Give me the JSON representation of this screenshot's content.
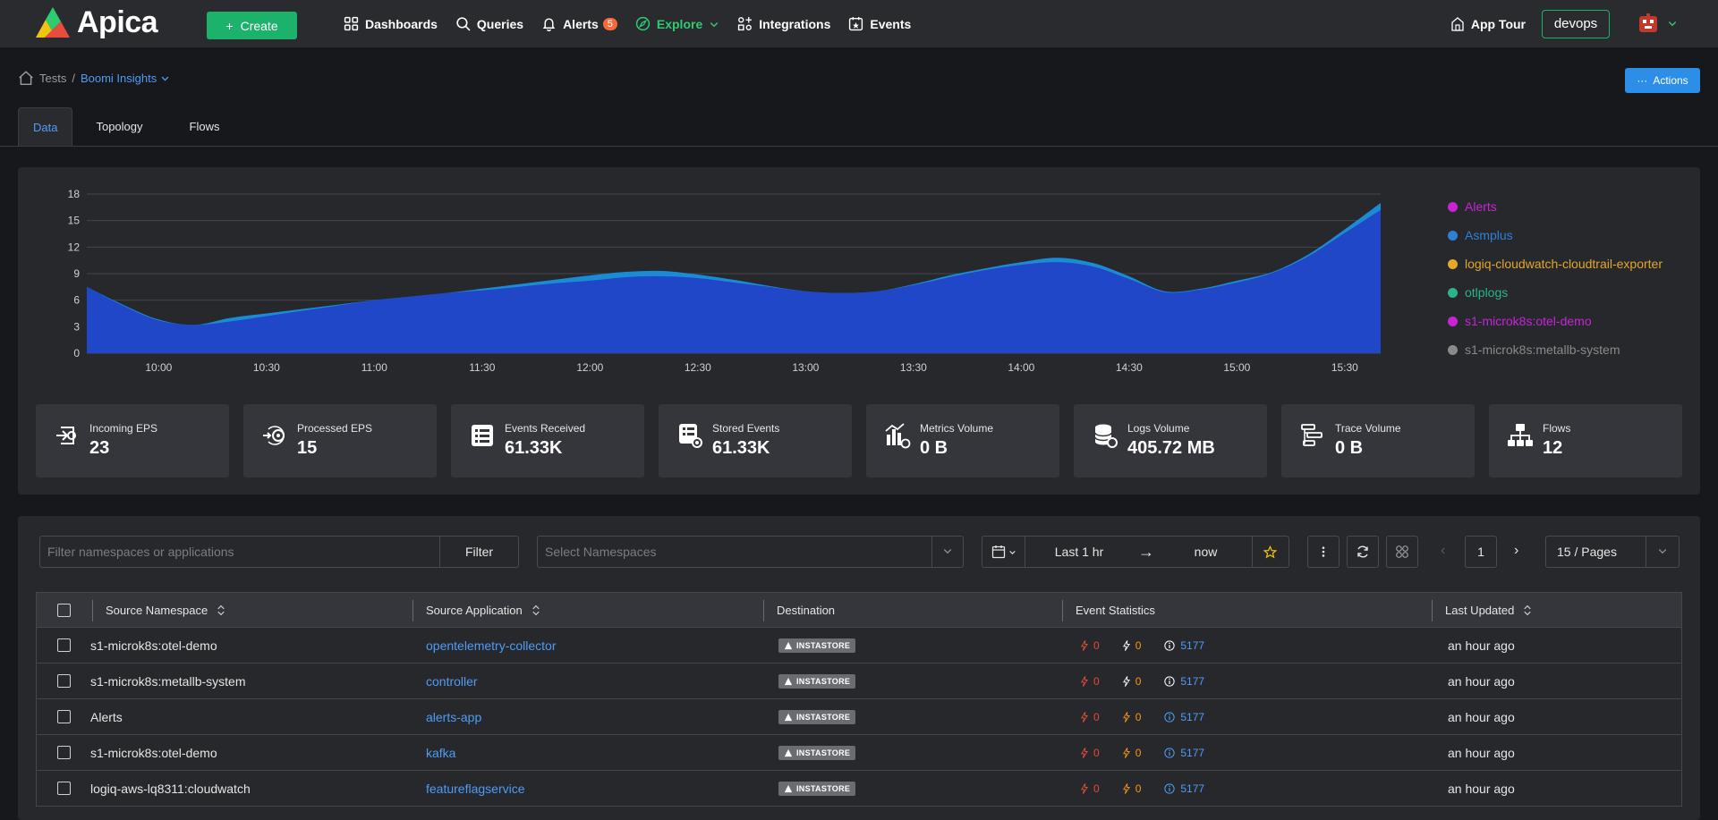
{
  "nav": {
    "logo": "Apica",
    "create_label": "Create",
    "items": [
      {
        "label": "Dashboards"
      },
      {
        "label": "Queries"
      },
      {
        "label": "Alerts",
        "badge": "5"
      },
      {
        "label": "Explore"
      },
      {
        "label": "Integrations"
      },
      {
        "label": "Events"
      }
    ],
    "app_tour": "App Tour",
    "org": "devops"
  },
  "breadcrumb": {
    "parent": "Tests",
    "current": "Boomi Insights"
  },
  "actions_label": "Actions",
  "tabs": [
    {
      "label": "Data"
    },
    {
      "label": "Topology"
    },
    {
      "label": "Flows"
    }
  ],
  "chart_data": {
    "type": "area",
    "x": [
      "09:40",
      "09:50",
      "10:00",
      "10:10",
      "10:20",
      "10:30",
      "10:40",
      "10:50",
      "11:00",
      "11:10",
      "11:20",
      "11:30",
      "11:40",
      "11:50",
      "12:00",
      "12:10",
      "12:20",
      "12:30",
      "12:40",
      "12:50",
      "13:00",
      "13:10",
      "13:20",
      "13:30",
      "13:40",
      "13:50",
      "14:00",
      "14:10",
      "14:20",
      "14:30",
      "14:40",
      "14:50",
      "15:00",
      "15:10",
      "15:20",
      "15:30",
      "15:40"
    ],
    "x_ticks": [
      "10:00",
      "10:30",
      "11:00",
      "11:30",
      "12:00",
      "12:30",
      "13:00",
      "13:30",
      "14:00",
      "14:30",
      "15:00",
      "15:30"
    ],
    "ylim": [
      0,
      18
    ],
    "y_ticks": [
      0,
      3,
      6,
      9,
      12,
      15,
      18
    ],
    "grid": true,
    "legend_position": "right",
    "series": [
      {
        "name": "Alerts",
        "color": "#c724d6",
        "values": [
          7.5,
          5.5,
          3.8,
          3.2,
          4.0,
          4.5,
          5.0,
          5.5,
          6.0,
          6.4,
          6.8,
          7.3,
          7.8,
          8.3,
          8.8,
          9.2,
          9.3,
          8.9,
          8.3,
          7.6,
          7.0,
          6.8,
          7.0,
          7.8,
          8.8,
          9.6,
          10.3,
          10.8,
          10.2,
          8.7,
          7.0,
          7.3,
          8.2,
          9.2,
          11.2,
          14.0,
          17.0
        ]
      },
      {
        "name": "Asmplus",
        "color": "#2f7fd8",
        "values": [
          7.5,
          5.4,
          3.7,
          3.2,
          3.6,
          4.2,
          4.8,
          5.4,
          6.0,
          6.4,
          6.8,
          7.1,
          7.5,
          7.9,
          8.2,
          8.6,
          8.7,
          8.5,
          8.0,
          7.5,
          7.0,
          6.8,
          7.0,
          7.7,
          8.6,
          9.4,
          10.0,
          10.3,
          9.8,
          8.4,
          6.9,
          7.2,
          8.0,
          9.1,
          11.0,
          13.6,
          16.2
        ]
      },
      {
        "name": "logiq-cloudwatch-cloudtrail-exporter",
        "color": "#e2a72b",
        "values": []
      },
      {
        "name": "otlplogs",
        "color": "#2bb38e",
        "values": []
      },
      {
        "name": "s1-microk8s:otel-demo",
        "color": "#c724d6",
        "values": []
      },
      {
        "name": "s1-microk8s:metallb-system",
        "color": "#8a8a8a",
        "values": []
      }
    ]
  },
  "stats": [
    {
      "label": "Incoming EPS",
      "value": "23",
      "icon": "incoming-eps-icon"
    },
    {
      "label": "Processed EPS",
      "value": "15",
      "icon": "processed-eps-icon"
    },
    {
      "label": "Events Received",
      "value": "61.33K",
      "icon": "events-received-icon"
    },
    {
      "label": "Stored Events",
      "value": "61.33K",
      "icon": "stored-events-icon"
    },
    {
      "label": "Metrics Volume",
      "value": "0 B",
      "icon": "metrics-volume-icon"
    },
    {
      "label": "Logs Volume",
      "value": "405.72 MB",
      "icon": "logs-volume-icon"
    },
    {
      "label": "Trace Volume",
      "value": "0 B",
      "icon": "trace-volume-icon"
    },
    {
      "label": "Flows",
      "value": "12",
      "icon": "flows-icon"
    }
  ],
  "filters": {
    "filter_placeholder": "Filter namespaces or applications",
    "filter_button": "Filter",
    "namespace_placeholder": "Select Namespaces",
    "time_from": "Last 1 hr",
    "time_to": "now",
    "page": "1",
    "per_page": "15 / Pages"
  },
  "table": {
    "columns": [
      "Source Namespace",
      "Source Application",
      "Destination",
      "Event Statistics",
      "Last Updated"
    ],
    "rows": [
      {
        "namespace": "s1-microk8s:otel-demo",
        "application": "opentelemetry-collector",
        "destination": "INSTASTORE",
        "errors": "0",
        "warnings": "0",
        "info": "5177",
        "updated": "an hour ago"
      },
      {
        "namespace": "s1-microk8s:metallb-system",
        "application": "controller",
        "destination": "INSTASTORE",
        "errors": "0",
        "warnings": "0",
        "info": "5177",
        "updated": "an hour ago"
      },
      {
        "namespace": "Alerts",
        "application": "alerts-app",
        "destination": "INSTASTORE",
        "errors": "0",
        "warnings": "0",
        "info": "5177",
        "updated": "an hour ago"
      },
      {
        "namespace": "s1-microk8s:otel-demo",
        "application": "kafka",
        "destination": "INSTASTORE",
        "errors": "0",
        "warnings": "0",
        "info": "5177",
        "updated": "an hour ago"
      },
      {
        "namespace": "logiq-aws-lq8311:cloudwatch",
        "application": "featureflagservice",
        "destination": "INSTASTORE",
        "errors": "0",
        "warnings": "0",
        "info": "5177",
        "updated": "an hour ago"
      }
    ]
  }
}
